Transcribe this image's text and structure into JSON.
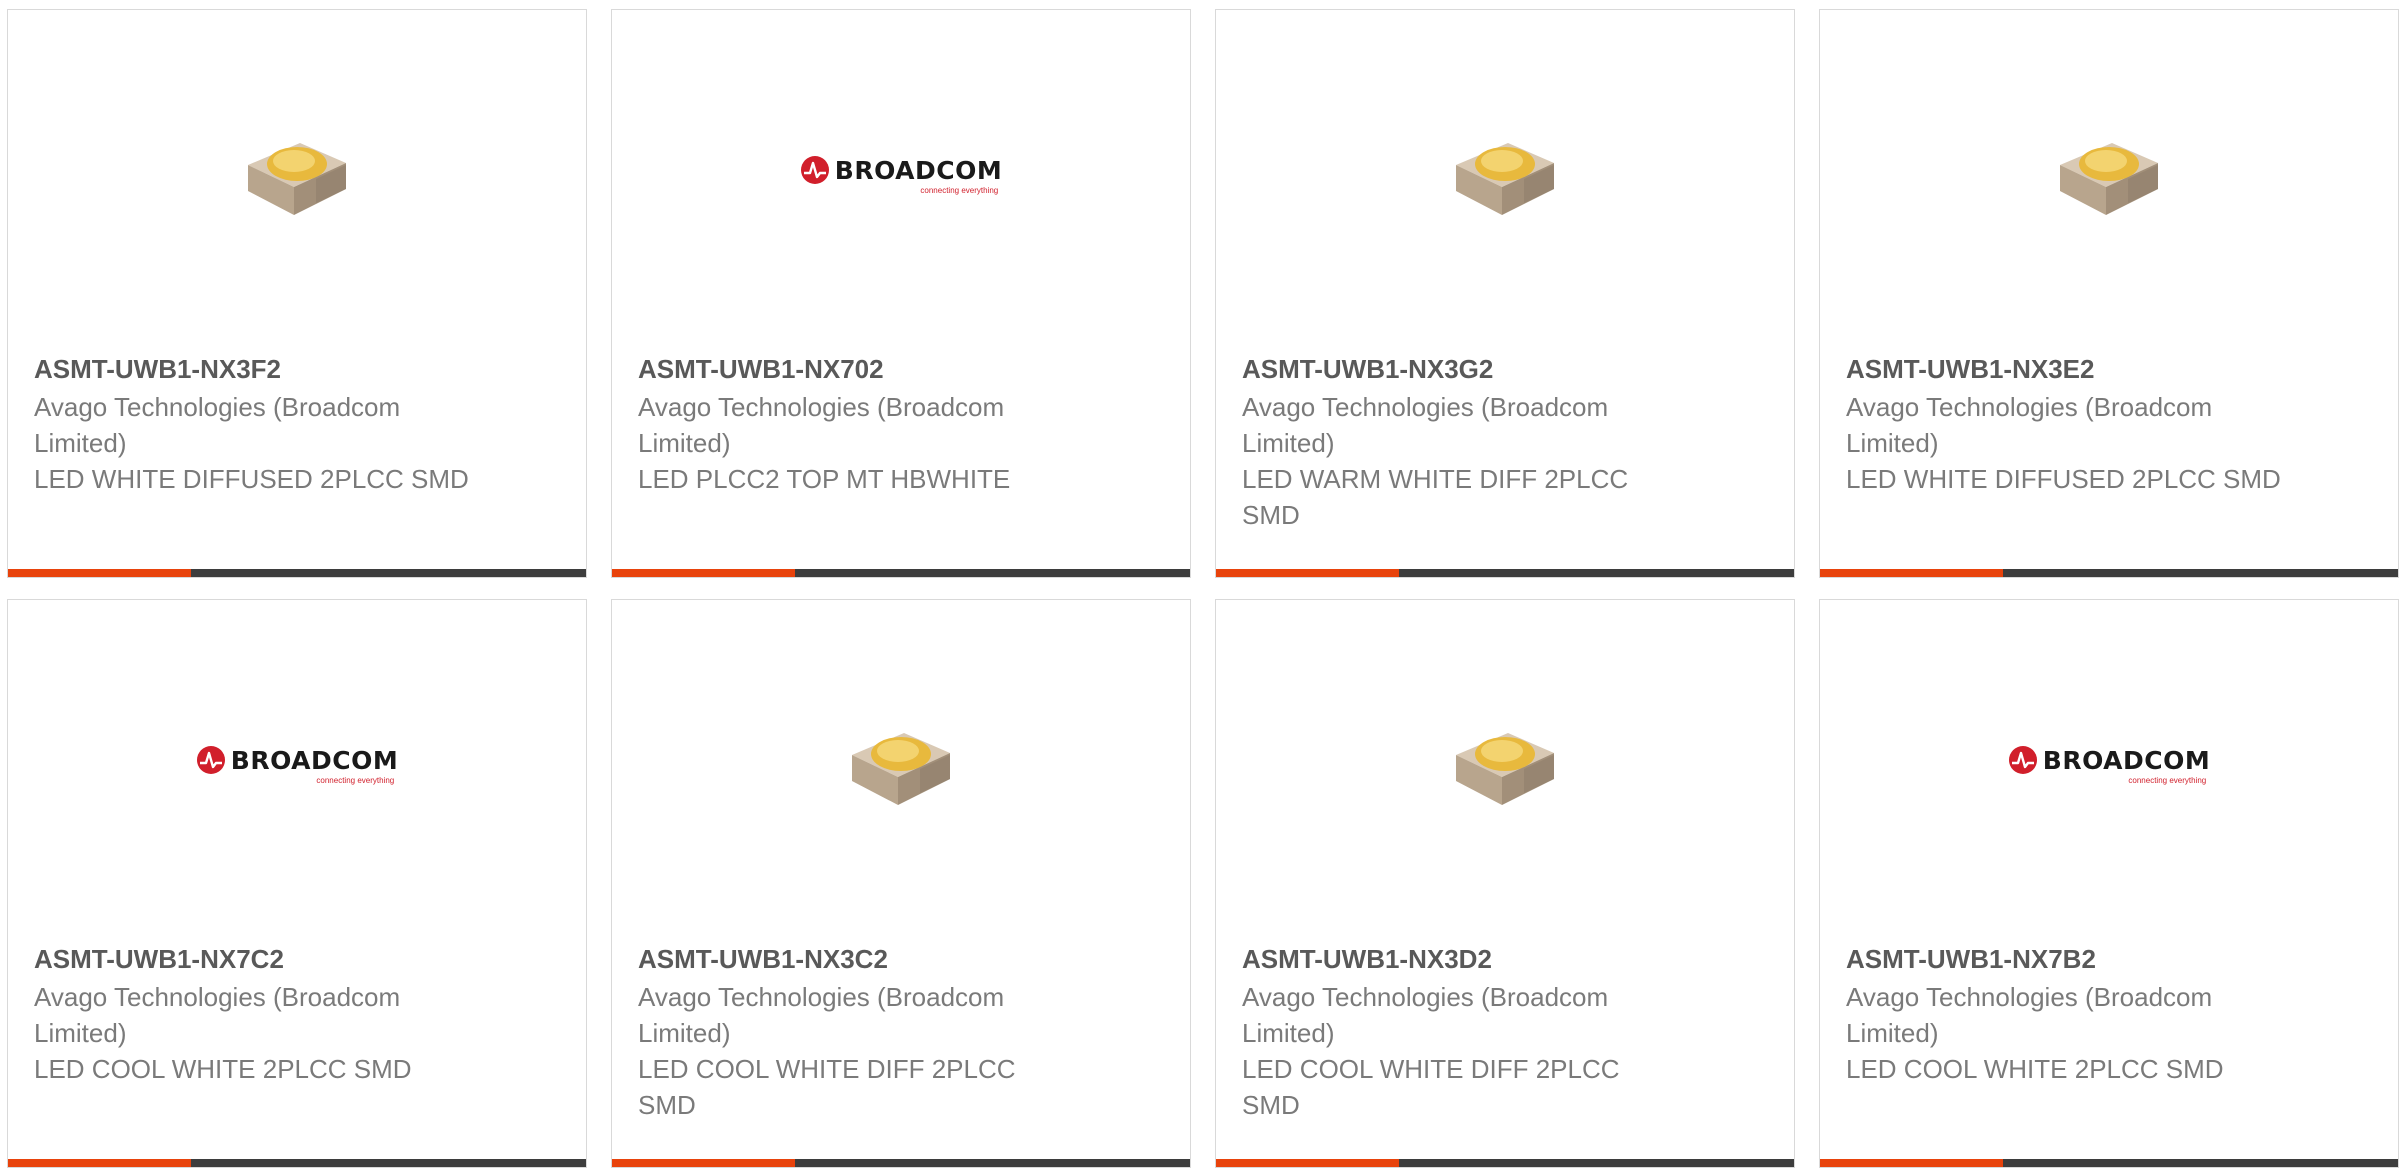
{
  "colors": {
    "accent": "#e8430c",
    "bar": "#3d3d3d",
    "card_border": "#d9d9d9",
    "title": "#595959",
    "text": "#7a7a7a",
    "brand_red": "#d11f2b"
  },
  "products": [
    {
      "mpn": "ASMT-UWB1-NX3F2",
      "maker": "Avago Technologies (Broadcom Limited)",
      "desc": "LED WHITE DIFFUSED 2PLCC SMD",
      "image": "led-chip-icon"
    },
    {
      "mpn": "ASMT-UWB1-NX702",
      "maker": "Avago Technologies (Broadcom Limited)",
      "desc": "LED PLCC2 TOP MT HBWHITE",
      "image": "broadcom-logo",
      "logo_text": "BROADCOM",
      "logo_tagline": "connecting everything"
    },
    {
      "mpn": "ASMT-UWB1-NX3G2",
      "maker": "Avago Technologies (Broadcom Limited)",
      "desc": "LED WARM WHITE DIFF 2PLCC SMD",
      "image": "led-chip-icon"
    },
    {
      "mpn": "ASMT-UWB1-NX3E2",
      "maker": "Avago Technologies (Broadcom Limited)",
      "desc": "LED WHITE DIFFUSED 2PLCC SMD",
      "image": "led-chip-icon"
    },
    {
      "mpn": "ASMT-UWB1-NX7C2",
      "maker": "Avago Technologies (Broadcom Limited)",
      "desc": "LED COOL WHITE 2PLCC SMD",
      "image": "broadcom-logo",
      "logo_text": "BROADCOM",
      "logo_tagline": "connecting everything"
    },
    {
      "mpn": "ASMT-UWB1-NX3C2",
      "maker": "Avago Technologies (Broadcom Limited)",
      "desc": "LED COOL WHITE DIFF 2PLCC SMD",
      "image": "led-chip-icon"
    },
    {
      "mpn": "ASMT-UWB1-NX3D2",
      "maker": "Avago Technologies (Broadcom Limited)",
      "desc": "LED COOL WHITE DIFF 2PLCC SMD",
      "image": "led-chip-icon"
    },
    {
      "mpn": "ASMT-UWB1-NX7B2",
      "maker": "Avago Technologies (Broadcom Limited)",
      "desc": "LED COOL WHITE 2PLCC SMD",
      "image": "broadcom-logo",
      "logo_text": "BROADCOM",
      "logo_tagline": "connecting everything"
    }
  ]
}
